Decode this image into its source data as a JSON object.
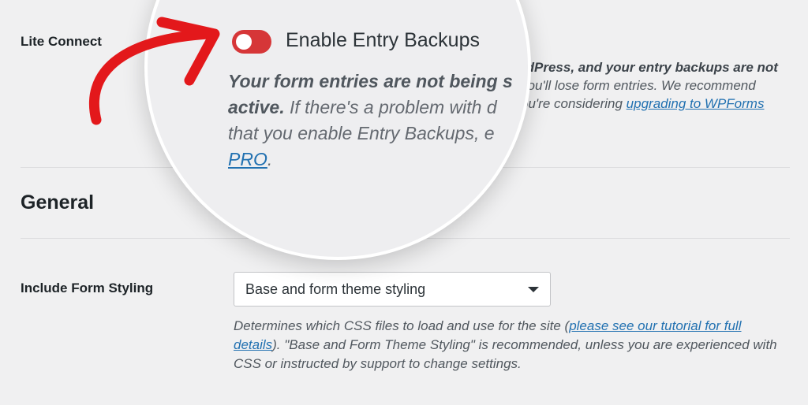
{
  "lite_connect": {
    "label": "Lite Connect",
    "toggle_label": "Enable Entry Backups",
    "toggle_state": "off",
    "desc_right_line1": "rdPress, and your entry backups are not",
    "desc_right_line2": "you'll lose form entries. We recommend",
    "desc_right_line3_pre": "ou're considering ",
    "desc_link": "upgrading to WPForms",
    "mag_line1_bold": "Your form entries are not being s",
    "mag_line2_bold": "active.",
    "mag_line2_rest": " If there's a problem with d",
    "mag_line3": "that you enable Entry Backups, e",
    "mag_link_pro": "PRO",
    "mag_line4_after": "."
  },
  "general": {
    "title": "General",
    "form_styling": {
      "label": "Include Form Styling",
      "selected": "Base and form theme styling",
      "desc_pre": "Determines which CSS files to load and use for the site (",
      "desc_link": "please see our tutorial for full details",
      "desc_post": "). \"Base and Form Theme Styling\" is recommended, unless you are experienced with CSS or instructed by support to change settings."
    }
  },
  "colors": {
    "toggle_off": "#d63638",
    "link": "#2271b1",
    "arrow": "#e3181b",
    "background": "#f0f0f1"
  }
}
